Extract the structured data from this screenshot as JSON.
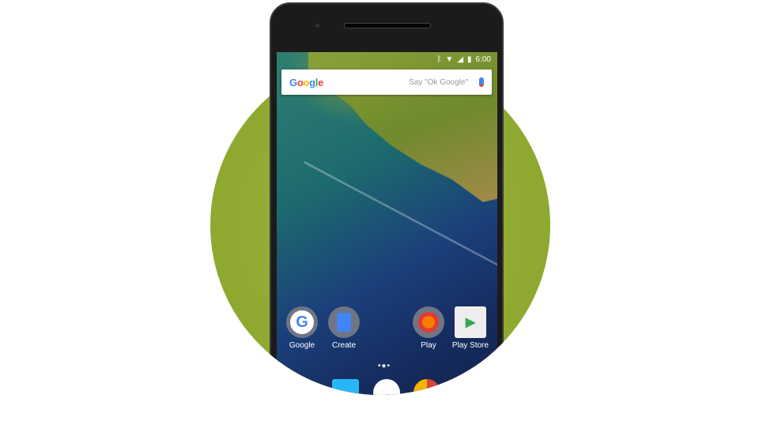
{
  "status_bar": {
    "time": "6:00",
    "icons": [
      "bluetooth-icon",
      "wifi-icon",
      "signal-icon",
      "battery-icon"
    ]
  },
  "search_widget": {
    "logo": "Google",
    "hint": "Say \"Ok Google\"",
    "mic_icon": "mic-icon"
  },
  "apps": [
    {
      "label": "Google",
      "icon": "google-icon"
    },
    {
      "label": "Create",
      "icon": "docs-icon"
    },
    {
      "label": "Play",
      "icon": "play-games-icon"
    },
    {
      "label": "Play Store",
      "icon": "play-store-icon"
    }
  ],
  "dock": [
    {
      "icon": "messages-icon"
    },
    {
      "icon": "app-drawer-icon"
    },
    {
      "icon": "chrome-icon"
    }
  ],
  "colors": {
    "circle": "#8aa52c",
    "phone": "#1b1b1b"
  }
}
